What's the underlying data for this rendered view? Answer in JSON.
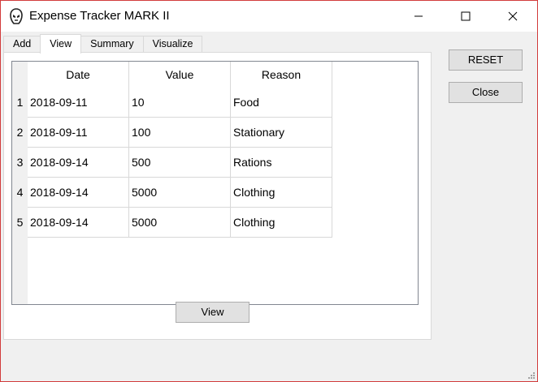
{
  "window": {
    "title": "Expense Tracker MARK II",
    "icon": "helmet-icon",
    "controls": [
      "minimize-icon",
      "maximize-icon",
      "close-icon"
    ]
  },
  "tabs": [
    {
      "label": "Add"
    },
    {
      "label": "View",
      "active": true
    },
    {
      "label": "Summary"
    },
    {
      "label": "Visualize"
    }
  ],
  "table": {
    "columns": [
      "Date",
      "Value",
      "Reason"
    ],
    "rows": [
      {
        "num": "1",
        "date": "2018-09-11",
        "value": "10",
        "reason": "Food"
      },
      {
        "num": "2",
        "date": "2018-09-11",
        "value": "100",
        "reason": "Stationary"
      },
      {
        "num": "3",
        "date": "2018-09-14",
        "value": "500",
        "reason": "Rations"
      },
      {
        "num": "4",
        "date": "2018-09-14",
        "value": "5000",
        "reason": "Clothing"
      },
      {
        "num": "5",
        "date": "2018-09-14",
        "value": "5000",
        "reason": "Clothing"
      }
    ]
  },
  "buttons": {
    "view": "View",
    "reset": "RESET",
    "close": "Close"
  },
  "colors": {
    "window_border": "#d23b3b",
    "button_bg": "#e1e1e1"
  }
}
